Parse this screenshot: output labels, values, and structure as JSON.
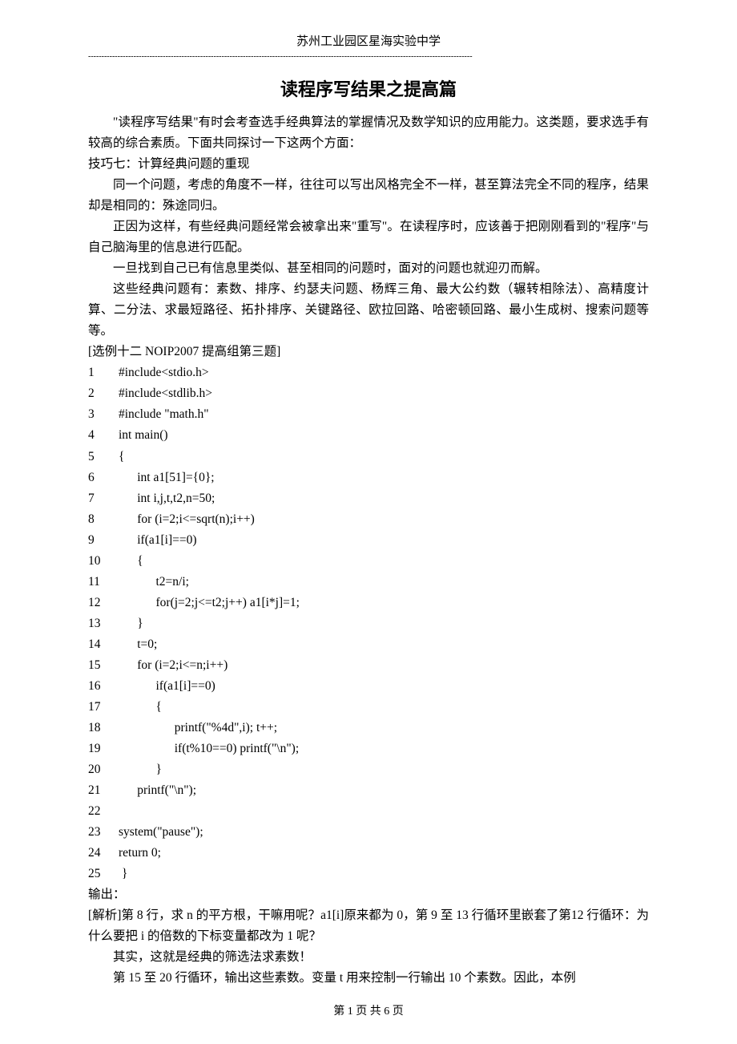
{
  "header": {
    "school": "苏州工业园区星海实验中学",
    "dashes": "------------------------------------------------------------------------------------------------------------------------------------------------"
  },
  "title": "读程序写结果之提高篇",
  "paragraphs": {
    "p1": "\"读程序写结果\"有时会考查选手经典算法的掌握情况及数学知识的应用能力。这类题，要求选手有较高的综合素质。下面共同探讨一下这两个方面：",
    "skill7": "技巧七：计算经典问题的重现",
    "p2": "同一个问题，考虑的角度不一样，往往可以写出风格完全不一样，甚至算法完全不同的程序，结果却是相同的：殊途同归。",
    "p3": "正因为这样，有些经典问题经常会被拿出来\"重写\"。在读程序时，应该善于把刚刚看到的\"程序\"与自己脑海里的信息进行匹配。",
    "p4": "一旦找到自己已有信息里类似、甚至相同的问题时，面对的问题也就迎刃而解。",
    "p5": "这些经典问题有：素数、排序、约瑟夫问题、杨辉三角、最大公约数（辗转相除法）、高精度计算、二分法、求最短路径、拓扑排序、关键路径、欧拉回路、哈密顿回路、最小生成树、搜索问题等等。",
    "example": "[选例十二  NOIP2007 提高组第三题]"
  },
  "code": [
    {
      "n": "1",
      "t": "#include<stdio.h>"
    },
    {
      "n": "2",
      "t": "#include<stdlib.h>"
    },
    {
      "n": "3",
      "t": "#include \"math.h\""
    },
    {
      "n": "4",
      "t": "int main()"
    },
    {
      "n": "5",
      "t": "{"
    },
    {
      "n": "6",
      "t": "      int a1[51]={0};"
    },
    {
      "n": "7",
      "t": "      int i,j,t,t2,n=50;"
    },
    {
      "n": "8",
      "t": "      for (i=2;i<=sqrt(n);i++)"
    },
    {
      "n": "9",
      "t": "      if(a1[i]==0)"
    },
    {
      "n": "10",
      "t": "      {"
    },
    {
      "n": "11",
      "t": "            t2=n/i;"
    },
    {
      "n": "12",
      "t": "            for(j=2;j<=t2;j++) a1[i*j]=1;"
    },
    {
      "n": "13",
      "t": "      }"
    },
    {
      "n": "14",
      "t": "      t=0;"
    },
    {
      "n": "15",
      "t": "      for (i=2;i<=n;i++)"
    },
    {
      "n": "16",
      "t": "            if(a1[i]==0)"
    },
    {
      "n": "17",
      "t": "            {"
    },
    {
      "n": "18",
      "t": "                  printf(\"%4d\",i); t++;"
    },
    {
      "n": "19",
      "t": "                  if(t%10==0) printf(\"\\n\");"
    },
    {
      "n": "20",
      "t": "            }"
    },
    {
      "n": "21",
      "t": "      printf(\"\\n\");"
    },
    {
      "n": "22",
      "t": ""
    },
    {
      "n": "23",
      "t": "system(\"pause\");"
    },
    {
      "n": "24",
      "t": "return 0;"
    },
    {
      "n": "25",
      "t": " }"
    }
  ],
  "after": {
    "output_label": "输出：",
    "analysis": "[解析]第 8 行，求 n 的平方根，干嘛用呢？a1[i]原来都为 0，第 9 至 13 行循环里嵌套了第12 行循环：为什么要把 i 的倍数的下标变量都改为 1 呢？",
    "a2": "其实，这就是经典的筛选法求素数！",
    "a3": "第 15 至 20 行循环，输出这些素数。变量 t 用来控制一行输出 10 个素数。因此，本例"
  },
  "footer": "第 1 页 共 6 页"
}
